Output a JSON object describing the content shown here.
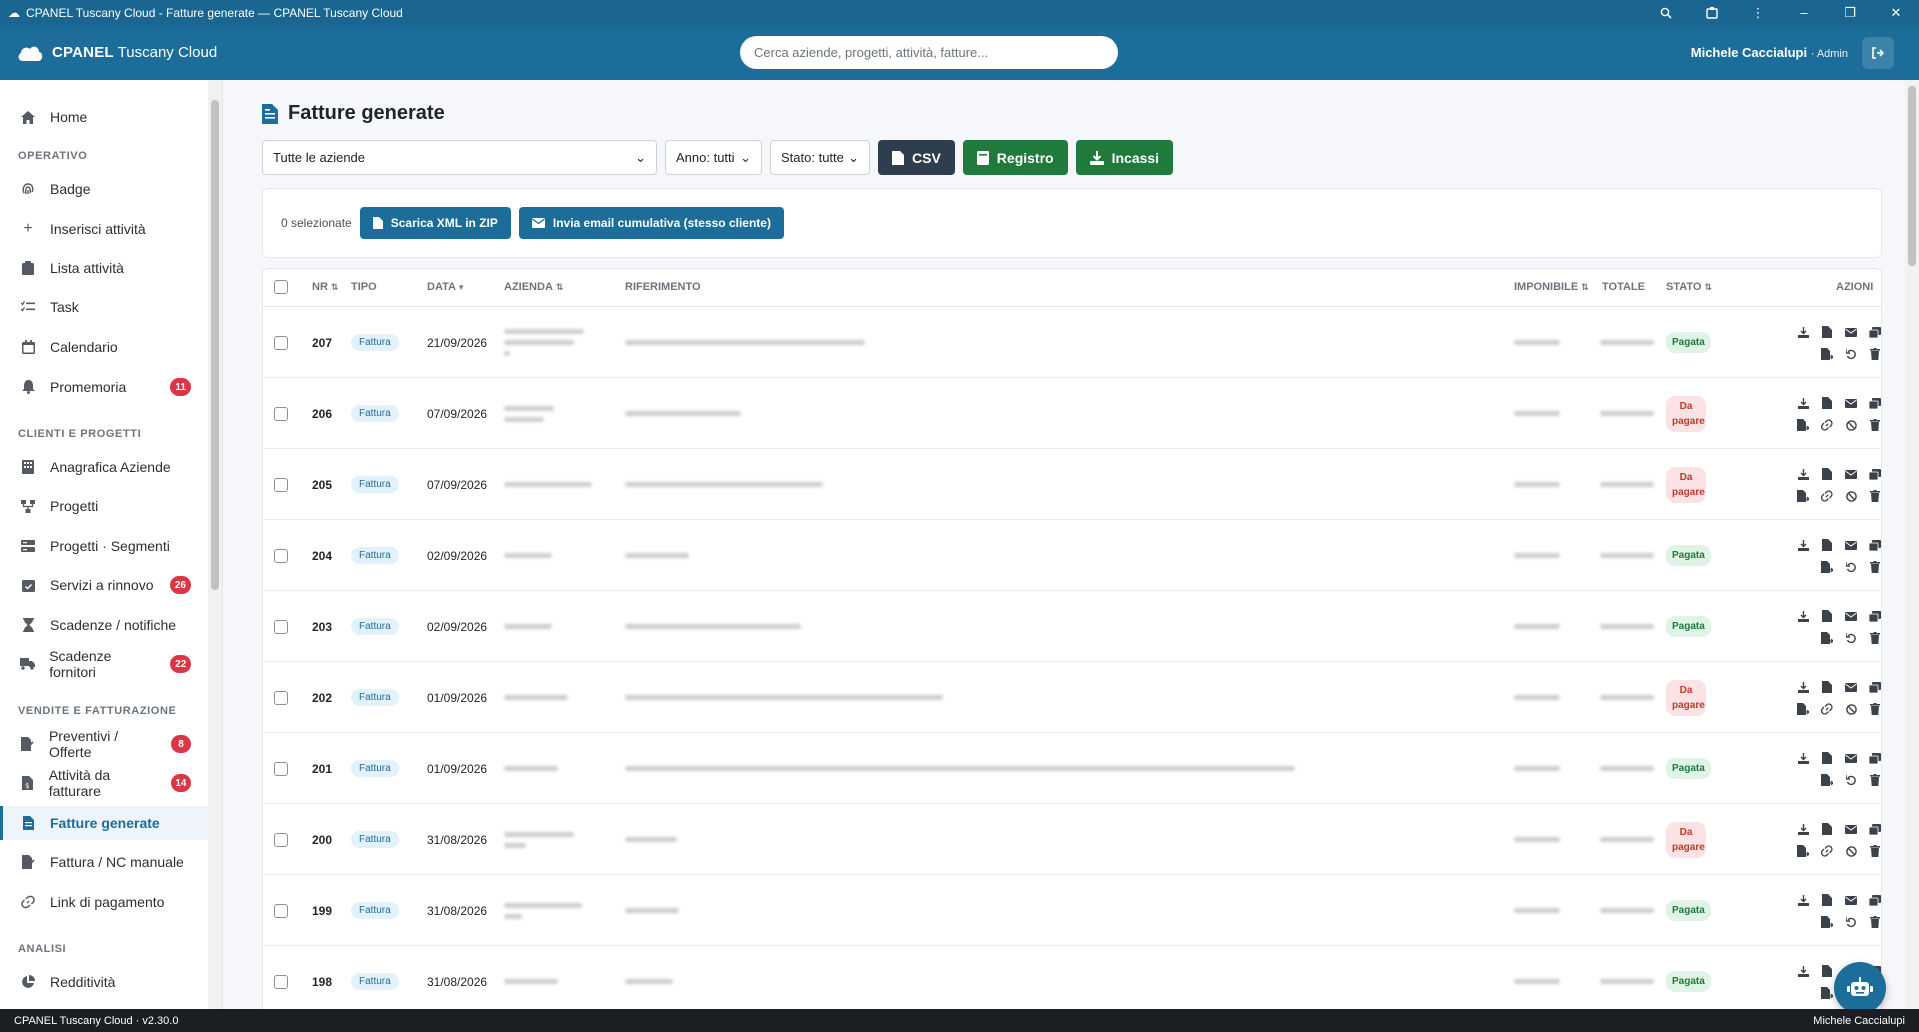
{
  "window": {
    "title": "CPANEL Tuscany Cloud - Fatture generate — CPANEL Tuscany Cloud"
  },
  "navbar": {
    "brand_bold": "CPANEL",
    "brand_rest": "Tuscany Cloud",
    "search_placeholder": "Cerca aziende, progetti, attività, fatture...",
    "user_name": "Michele Caccialupi",
    "user_role": "· Admin"
  },
  "sidebar": {
    "home": "Home",
    "sections": {
      "operativo": "OPERATIVO",
      "clienti": "CLIENTI E PROGETTI",
      "vendite": "VENDITE E FATTURAZIONE",
      "analisi": "ANALISI"
    },
    "items": [
      {
        "label": "Badge"
      },
      {
        "label": "Inserisci attività"
      },
      {
        "label": "Lista attività"
      },
      {
        "label": "Task"
      },
      {
        "label": "Calendario"
      },
      {
        "label": "Promemoria",
        "badge": "11"
      },
      {
        "label": "Anagrafica Aziende"
      },
      {
        "label": "Progetti"
      },
      {
        "label": "Progetti · Segmenti"
      },
      {
        "label": "Servizi a rinnovo",
        "badge": "26"
      },
      {
        "label": "Scadenze / notifiche"
      },
      {
        "label": "Scadenze fornitori",
        "badge": "22"
      },
      {
        "label": "Preventivi / Offerte",
        "badge": "8"
      },
      {
        "label": "Attività da fatturare",
        "badge": "14"
      },
      {
        "label": "Fatture generate"
      },
      {
        "label": "Fattura / NC manuale"
      },
      {
        "label": "Link di pagamento"
      },
      {
        "label": "Redditività"
      }
    ]
  },
  "page": {
    "title": "Fatture generate",
    "filters": {
      "aziende": "Tutte le aziende",
      "anno": "Anno: tutti",
      "stato": "Stato: tutte"
    },
    "buttons": {
      "csv": "CSV",
      "registro": "Registro",
      "incassi": "Incassi"
    },
    "selection": {
      "count": "0 selezionate",
      "zip": "Scarica XML in ZIP",
      "email": "Invia email cumulativa (stesso cliente)"
    },
    "table": {
      "headers": {
        "nr": "NR",
        "tipo": "TIPO",
        "data": "DATA",
        "azienda": "AZIENDA",
        "riferimento": "RIFERIMENTO",
        "imponibile": "IMPONIBILE",
        "totale": "TOTALE",
        "stato": "STATO",
        "azioni": "AZIONI"
      },
      "rows": [
        {
          "nr": "207",
          "tipo": "Fattura",
          "data": "21/09/2026",
          "stato": "Pagata"
        },
        {
          "nr": "206",
          "tipo": "Fattura",
          "data": "07/09/2026",
          "stato": "Da pagare"
        },
        {
          "nr": "205",
          "tipo": "Fattura",
          "data": "07/09/2026",
          "stato": "Da pagare"
        },
        {
          "nr": "204",
          "tipo": "Fattura",
          "data": "02/09/2026",
          "stato": "Pagata"
        },
        {
          "nr": "203",
          "tipo": "Fattura",
          "data": "02/09/2026",
          "stato": "Pagata"
        },
        {
          "nr": "202",
          "tipo": "Fattura",
          "data": "01/09/2026",
          "stato": "Da pagare"
        },
        {
          "nr": "201",
          "tipo": "Fattura",
          "data": "01/09/2026",
          "stato": "Pagata"
        },
        {
          "nr": "200",
          "tipo": "Fattura",
          "data": "31/08/2026",
          "stato": "Da pagare"
        },
        {
          "nr": "199",
          "tipo": "Fattura",
          "data": "31/08/2026",
          "stato": "Pagata"
        },
        {
          "nr": "198",
          "tipo": "Fattura",
          "data": "31/08/2026",
          "stato": "Pagata"
        }
      ]
    }
  },
  "footer": {
    "left": "CPANEL Tuscany Cloud · v2.30.0",
    "right": "Michele Caccialupi"
  },
  "colors": {
    "primary": "#1c6d99",
    "green": "#1f7a3c",
    "dark": "#2f3e4e",
    "danger": "#dc3545"
  }
}
